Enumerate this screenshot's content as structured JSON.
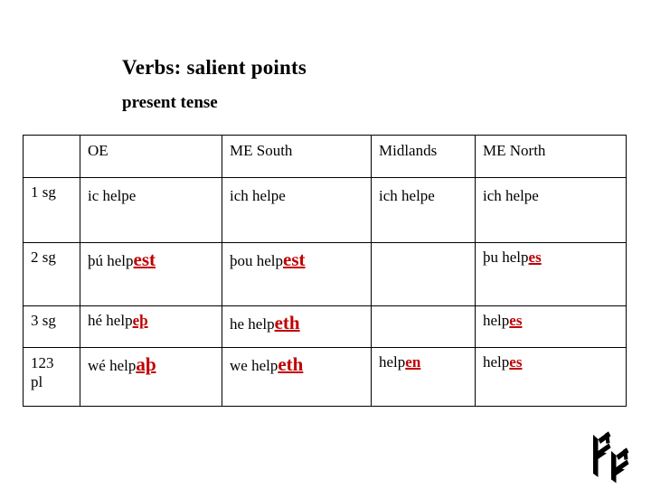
{
  "slide": {
    "title": "Verbs: salient points",
    "subtitle": "present  tense",
    "accent_color": "#c00000",
    "text_color": "#000000",
    "background_color": "#ffffff",
    "decoration_icon": "rune-glyph"
  },
  "table": {
    "headers": [
      "",
      "OE",
      "ME South",
      "Midlands",
      "ME North"
    ],
    "rows": [
      {
        "label": "1 sg",
        "cells": [
          {
            "stem": "ic helpe",
            "ending": ""
          },
          {
            "stem": "ich helpe",
            "ending": ""
          },
          {
            "stem": "ich helpe",
            "ending": ""
          },
          {
            "stem": "ich helpe",
            "ending": ""
          }
        ]
      },
      {
        "label": "2 sg",
        "cells": [
          {
            "stem": "þú help",
            "ending": "est"
          },
          {
            "stem": "þou help",
            "ending": "est"
          },
          {
            "stem": "",
            "ending": ""
          },
          {
            "stem": "þu help",
            "ending": "es"
          }
        ]
      },
      {
        "label": "3 sg",
        "cells": [
          {
            "stem": "hé help",
            "ending": "eþ"
          },
          {
            "stem": "he help",
            "ending": "eth"
          },
          {
            "stem": "",
            "ending": ""
          },
          {
            "stem": "help",
            "ending": "es"
          }
        ]
      },
      {
        "label": "123\npl",
        "cells": [
          {
            "stem": "wé help",
            "ending": "aþ"
          },
          {
            "stem": "we help",
            "ending": "eth"
          },
          {
            "stem": "help",
            "ending": "en"
          },
          {
            "stem": "help",
            "ending": "es"
          }
        ]
      }
    ]
  }
}
